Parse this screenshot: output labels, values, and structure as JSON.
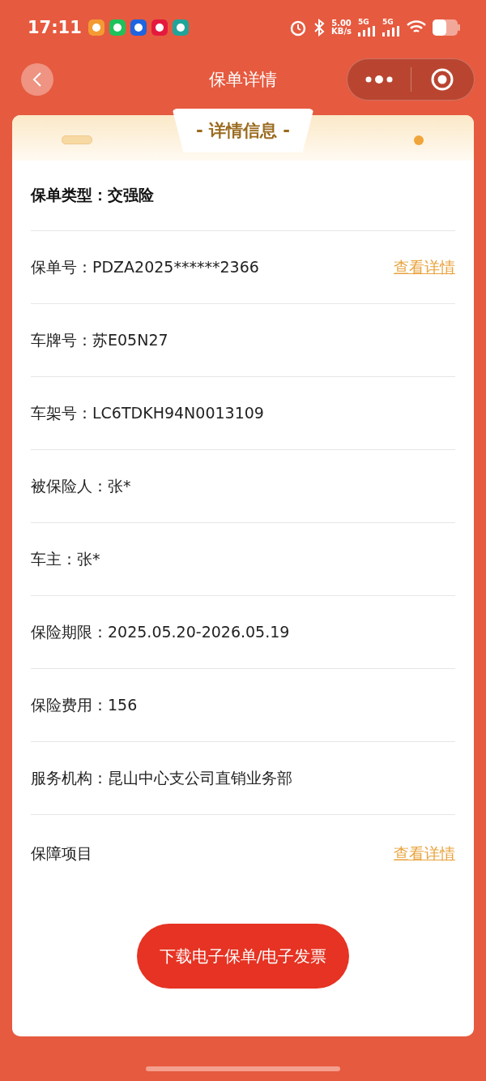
{
  "status_bar": {
    "time": "17:11",
    "speed": "5.00",
    "speed_unit": "KB/s",
    "networks": [
      "5G",
      "5G"
    ]
  },
  "header": {
    "title": "保单详情"
  },
  "card": {
    "banner": "- 详情信息 -",
    "heading": "保单类型：交强险",
    "rows": [
      {
        "text": "保单号：PDZA2025******2366",
        "link": "查看详情"
      },
      {
        "text": "车牌号：苏E05N27"
      },
      {
        "text": "车架号：LC6TDKH94N0013109"
      },
      {
        "text": "被保险人：张*"
      },
      {
        "text": "车主：张*"
      },
      {
        "text": "保险期限：2025.05.20-2026.05.19"
      },
      {
        "text": "保险费用：156"
      },
      {
        "text": "服务机构：昆山中心支公司直销业务部"
      },
      {
        "text": "保障项目",
        "link": "查看详情"
      }
    ],
    "button": "下载电子保单/电子发票"
  }
}
